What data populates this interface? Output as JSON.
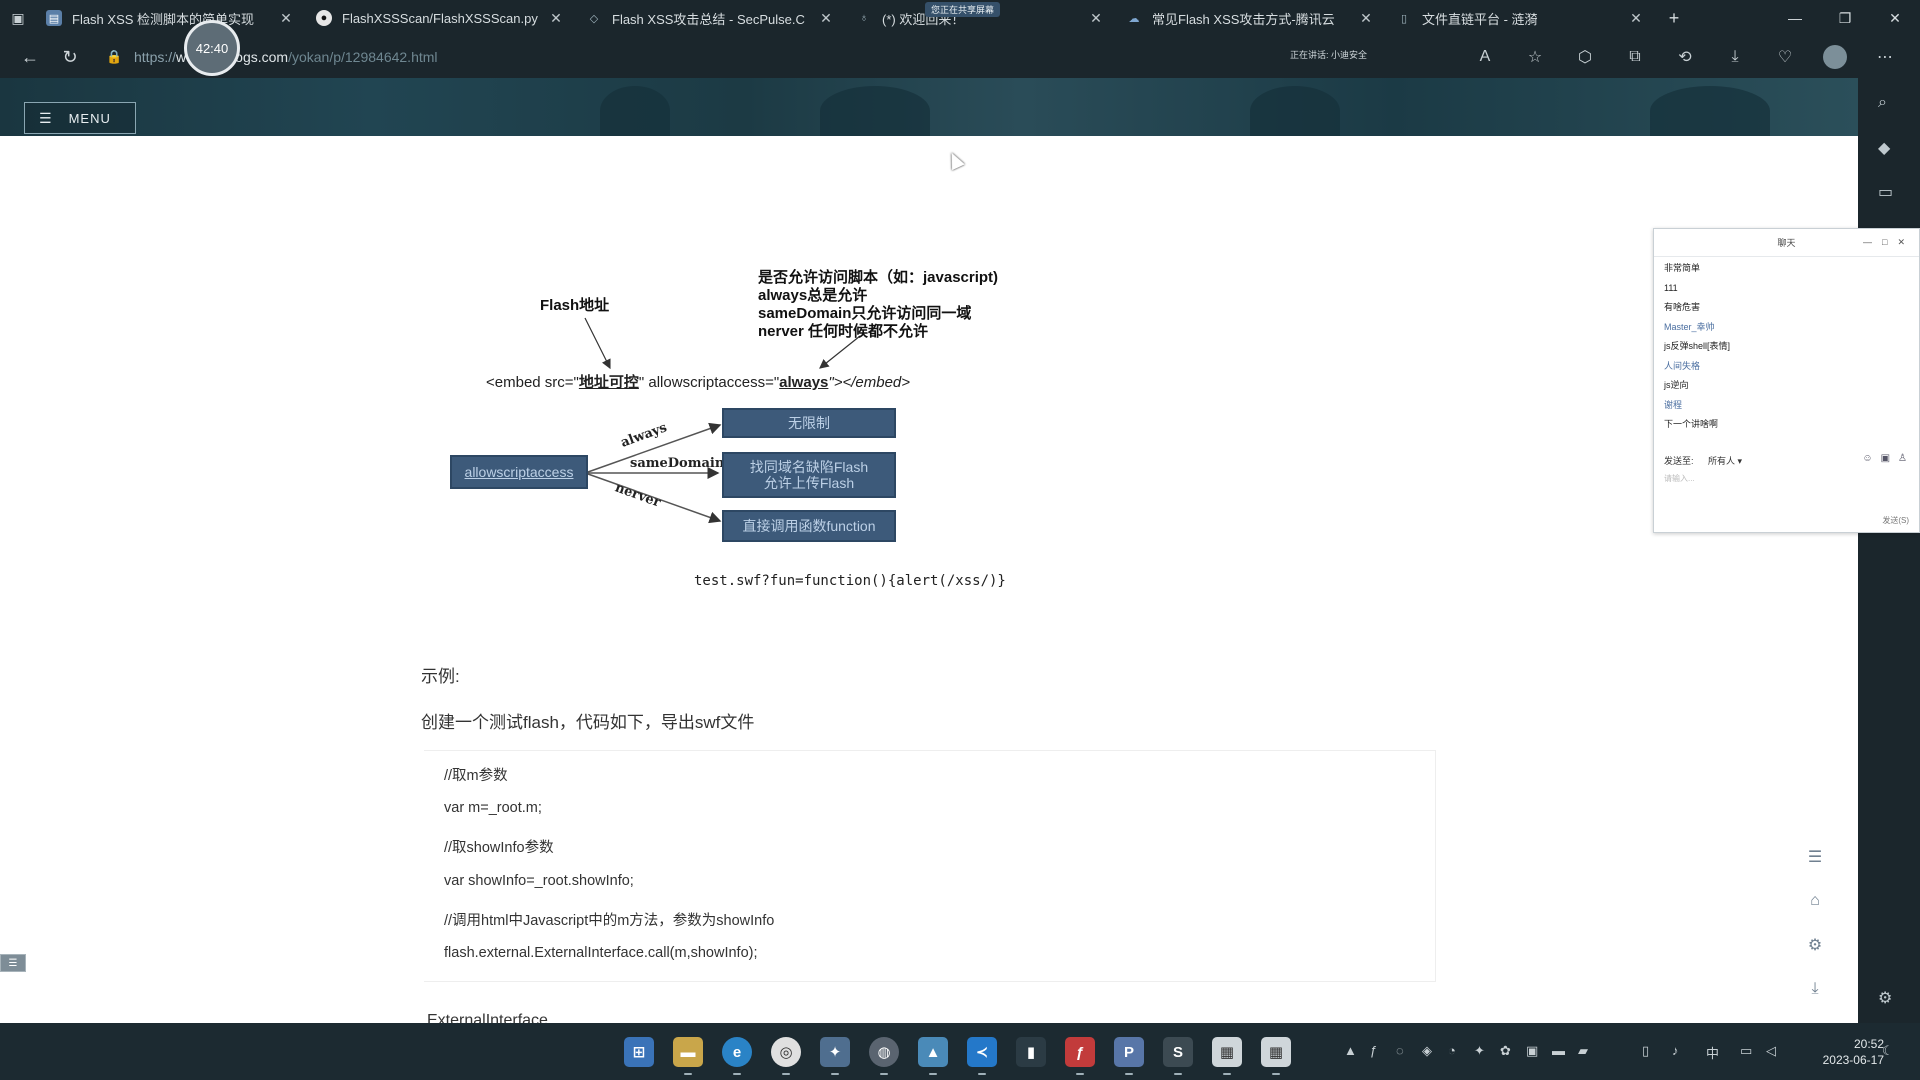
{
  "browser": {
    "tabs": [
      {
        "title": "Flash XSS 检测脚本的简单实现",
        "icon": "page-icon"
      },
      {
        "title": "FlashXSSScan/FlashXSSScan.py",
        "icon": "github-icon"
      },
      {
        "title": "Flash XSS攻击总结 - SecPulse.C",
        "icon": "shield-icon"
      },
      {
        "title": "(*) 欢迎回来！",
        "icon": "user-icon"
      },
      {
        "title": "常见Flash XSS攻击方式-腾讯云",
        "icon": "cloud-icon"
      },
      {
        "title": "文件直链平台 - 涟漪",
        "icon": "doc-icon"
      }
    ],
    "share_badge": "您正在共享屏幕",
    "url_prefix": "https://",
    "url_host": "www.cnblogs.com",
    "url_path": "/yokan/p/12984642.html",
    "speaking": "正在讲话: 小迪安全",
    "timer": "42:40"
  },
  "page": {
    "menu_label": "MENU",
    "diagram": {
      "flash_addr": "Flash地址",
      "note_lines": [
        "是否允许访问脚本（如：javascript)",
        "always总是允许",
        "sameDomain只允许访问同一域",
        "nerver 任何时候都不允许"
      ],
      "embed_pre": "<embed src=\"",
      "embed_src": "地址可控",
      "embed_mid": "\" allowscriptaccess=\"",
      "embed_val": "always",
      "embed_post": "\"></embed>",
      "source_box": "allowscriptaccess",
      "edge_always": "always",
      "edge_same": "sameDomain",
      "edge_never": "nerver",
      "box_unlimited": "无限制",
      "box_same_l1": "找同域名缺陷Flash",
      "box_same_l2": "允许上传Flash",
      "box_call": "直接调用函数function",
      "test_url": "test.swf?fun=function(){alert(/xss/)}"
    },
    "example_label": "示例:",
    "intro": "创建一个测试flash，代码如下，导出swf文件",
    "code_lines": [
      "//取m参数",
      "var m=_root.m;",
      "//取showInfo参数",
      "var showInfo=_root.showInfo;",
      "//调用html中Javascript中的m方法，参数为showInfo",
      "flash.external.ExternalInterface.call(m,showInfo);"
    ],
    "next_heading": "ExternalInterface"
  },
  "chat": {
    "title": "聊天",
    "messages": [
      "非常简单",
      "111",
      "有啥危害",
      "Master_幸帅",
      "js反弹shell[表情]",
      "人间失格",
      "js逆向",
      "谢程",
      "下一个讲啥啊"
    ],
    "send_to_label": "发送至:",
    "send_to_value": "所有人",
    "input_placeholder": "请输入...",
    "send_button": "发送(S)"
  },
  "taskbar": {
    "apps": [
      "start",
      "files",
      "edge",
      "chrome",
      "app-p",
      "browser2",
      "gallery",
      "vscode",
      "terminal",
      "flash",
      "publisher",
      "sublime",
      "app-a",
      "app-b"
    ],
    "ime": "中",
    "time": "20:52",
    "date": "2023-06-17"
  }
}
